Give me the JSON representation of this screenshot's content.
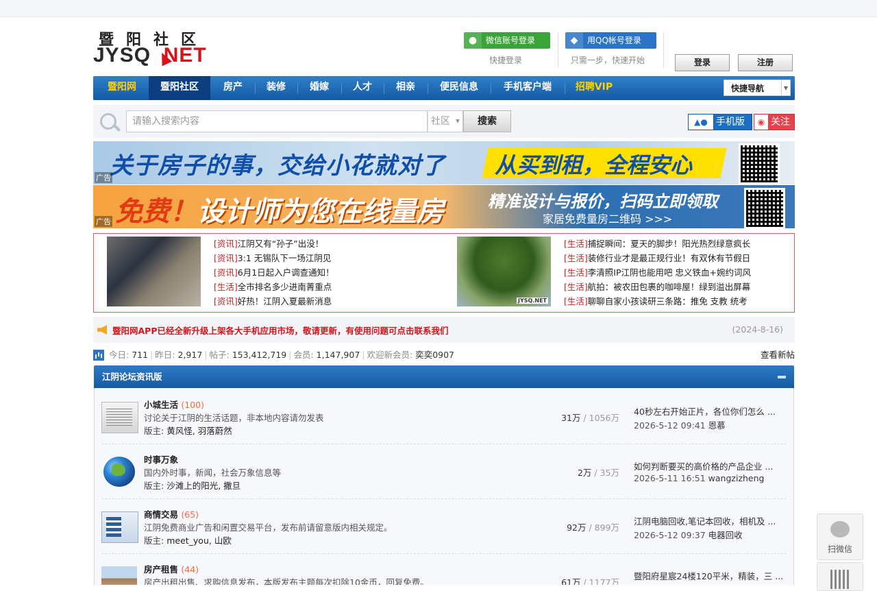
{
  "header": {
    "logo_cn": "暨阳社区",
    "logo_en_left": "JYSQ",
    "logo_en_right": "NET",
    "wechat_login": "微信账号登录",
    "wechat_sub": "快捷登录",
    "qq_login": "用QQ帐号登录",
    "qq_sub": "只需一步，快速开始",
    "login": "登录",
    "register": "注册"
  },
  "nav": {
    "items": [
      "暨阳网",
      "暨阳社区",
      "房产",
      "装修",
      "婚嫁",
      "人才",
      "相亲",
      "便民信息",
      "手机客户端",
      "招聘VIP"
    ],
    "quick": "快捷导航"
  },
  "search": {
    "placeholder": "请输入搜索内容",
    "scope": "社区",
    "button": "搜索",
    "mobile": "手机版",
    "follow": "关注"
  },
  "banners": {
    "b1_main": "关于房子的事，交给小花就对了",
    "b1_right": "从买到租，全程安心",
    "b2_main_1": "免费！",
    "b2_main_2": "设计师为您在线量房",
    "b2_right": "精准设计与报价，扫码立即领取",
    "b2_sub": "家居免费量房二维码 >>>",
    "ad_label": "广告"
  },
  "news": {
    "left": [
      {
        "tag": "[资讯]",
        "title": "江阴又有“孙子”出没！"
      },
      {
        "tag": "[资讯]",
        "title": "3:1 无锡队下一场江阴见"
      },
      {
        "tag": "[资讯]",
        "title": "6月1日起入户调查通知！"
      },
      {
        "tag": "[生活]",
        "title": "全市排名多少进南菁重点"
      },
      {
        "tag": "[资讯]",
        "title": "好热！江阴入夏最新消息"
      }
    ],
    "right": [
      {
        "tag": "[生活]",
        "title": "捕捉瞬间：夏天的脚步！阳光热烈绿意疯长"
      },
      {
        "tag": "[生活]",
        "title": "装修行业才是最正规行业！有双休有节假日"
      },
      {
        "tag": "[生活]",
        "title": "李清照IP江阴也能用吧 忠义铁血+婉约词风"
      },
      {
        "tag": "[生活]",
        "title": "航拍：被农田包裹的咖啡屋！绿到溢出屏幕"
      },
      {
        "tag": "[生活]",
        "title": "聊聊自家小孩读研三条路：推免 支教 统考"
      }
    ],
    "img_watermark": "JYSQ.NET"
  },
  "notice": {
    "text": "暨阳网APP已经全新升级上架各大手机应用市场，敬请更新，有使用问题可点击联系我们",
    "date": "(2024-8-16)"
  },
  "stats": {
    "today_label": "今日:",
    "today": "711",
    "yesterday_label": "昨日:",
    "yesterday": "2,917",
    "posts_label": "帖子:",
    "posts": "153,412,719",
    "members_label": "会员:",
    "members": "1,147,907",
    "welcome_label": "欢迎新会员:",
    "newest": "奕奕0907",
    "new_posts": "查看新帖"
  },
  "forum": {
    "section_title": "江阴论坛资讯版",
    "boards": [
      {
        "name": "小城生活",
        "count": "(100)",
        "desc": "讨论关于江阴的生活话题，非本地内容请勿发表",
        "mods_label": "版主:",
        "mods": "黄风怪, 羽落蔚然",
        "threads": "31万",
        "posts": " / 1056万",
        "last_title": "40秒左右开始正片，各位你们怎么 ...",
        "last_time": "2026-5-12 09:41",
        "last_user": "恩慕"
      },
      {
        "name": "时事万象",
        "count": "",
        "desc": "国内外时事，新闻，社会万象信息等",
        "mods_label": "版主:",
        "mods": "沙滩上的阳光, 撒旦",
        "threads": "2万",
        "posts": " / 35万",
        "last_title": "如何判断要买的高价格的产品企业 ...",
        "last_time": "2026-5-11 16:51",
        "last_user": "wangzizheng"
      },
      {
        "name": "商情交易",
        "count": "(65)",
        "desc": "江阴免费商业广告和闲置交易平台，发布前请留意版内相关规定。",
        "mods_label": "版主:",
        "mods": "meet_you, 山欧",
        "threads": "92万",
        "posts": " / 899万",
        "last_title": "江阴电脑回收,笔记本回收，相机及 ...",
        "last_time": "2026-5-12 09:37",
        "last_user": "电器回收"
      },
      {
        "name": "房产租售",
        "count": "(44)",
        "desc": "房产出租出售、求购信息发布，本版发布主题每次扣除10金币，回复免费。",
        "mods_label": "",
        "mods": "",
        "threads": "61万",
        "posts": " / 1177万",
        "last_title": "暨阳府星宸24楼120平米，精装，三 ...",
        "last_time": "",
        "last_user": ""
      }
    ]
  },
  "float": {
    "wechat": "扫微信"
  }
}
